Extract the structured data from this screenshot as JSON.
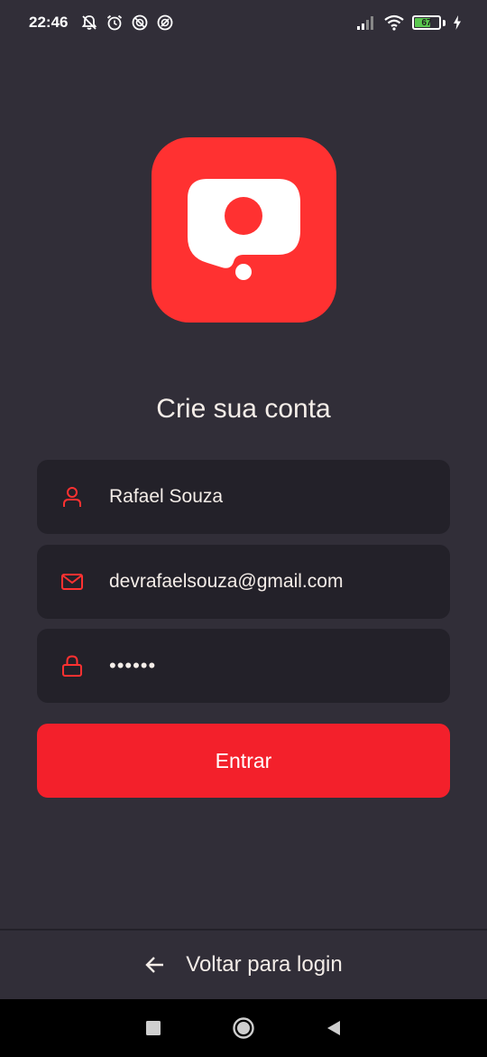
{
  "status_bar": {
    "time": "22:46",
    "battery_percent": "67",
    "battery_level": 0.67,
    "left_icons": [
      "bell-off-icon",
      "alarm-icon",
      "dnd-icon",
      "data-saver-icon"
    ],
    "right_icons": [
      "signal-icon",
      "wifi-icon",
      "battery-icon",
      "charging-icon"
    ]
  },
  "app": {
    "logo": "app-logo",
    "brand_color": "#ff3131"
  },
  "title": "Crie sua conta",
  "form": {
    "name_value": "Rafael Souza",
    "email_value": "devrafaelsouza@gmail.com",
    "password_value": "••••••",
    "submit_label": "Entrar",
    "icons": [
      "user-icon",
      "mail-icon",
      "lock-icon"
    ]
  },
  "footer": {
    "back_label": "Voltar para login",
    "back_icon": "arrow-left-icon"
  },
  "colors": {
    "background": "#312e38",
    "input_background": "#232129",
    "accent": "#f3202b",
    "text": "#f4ede8"
  }
}
